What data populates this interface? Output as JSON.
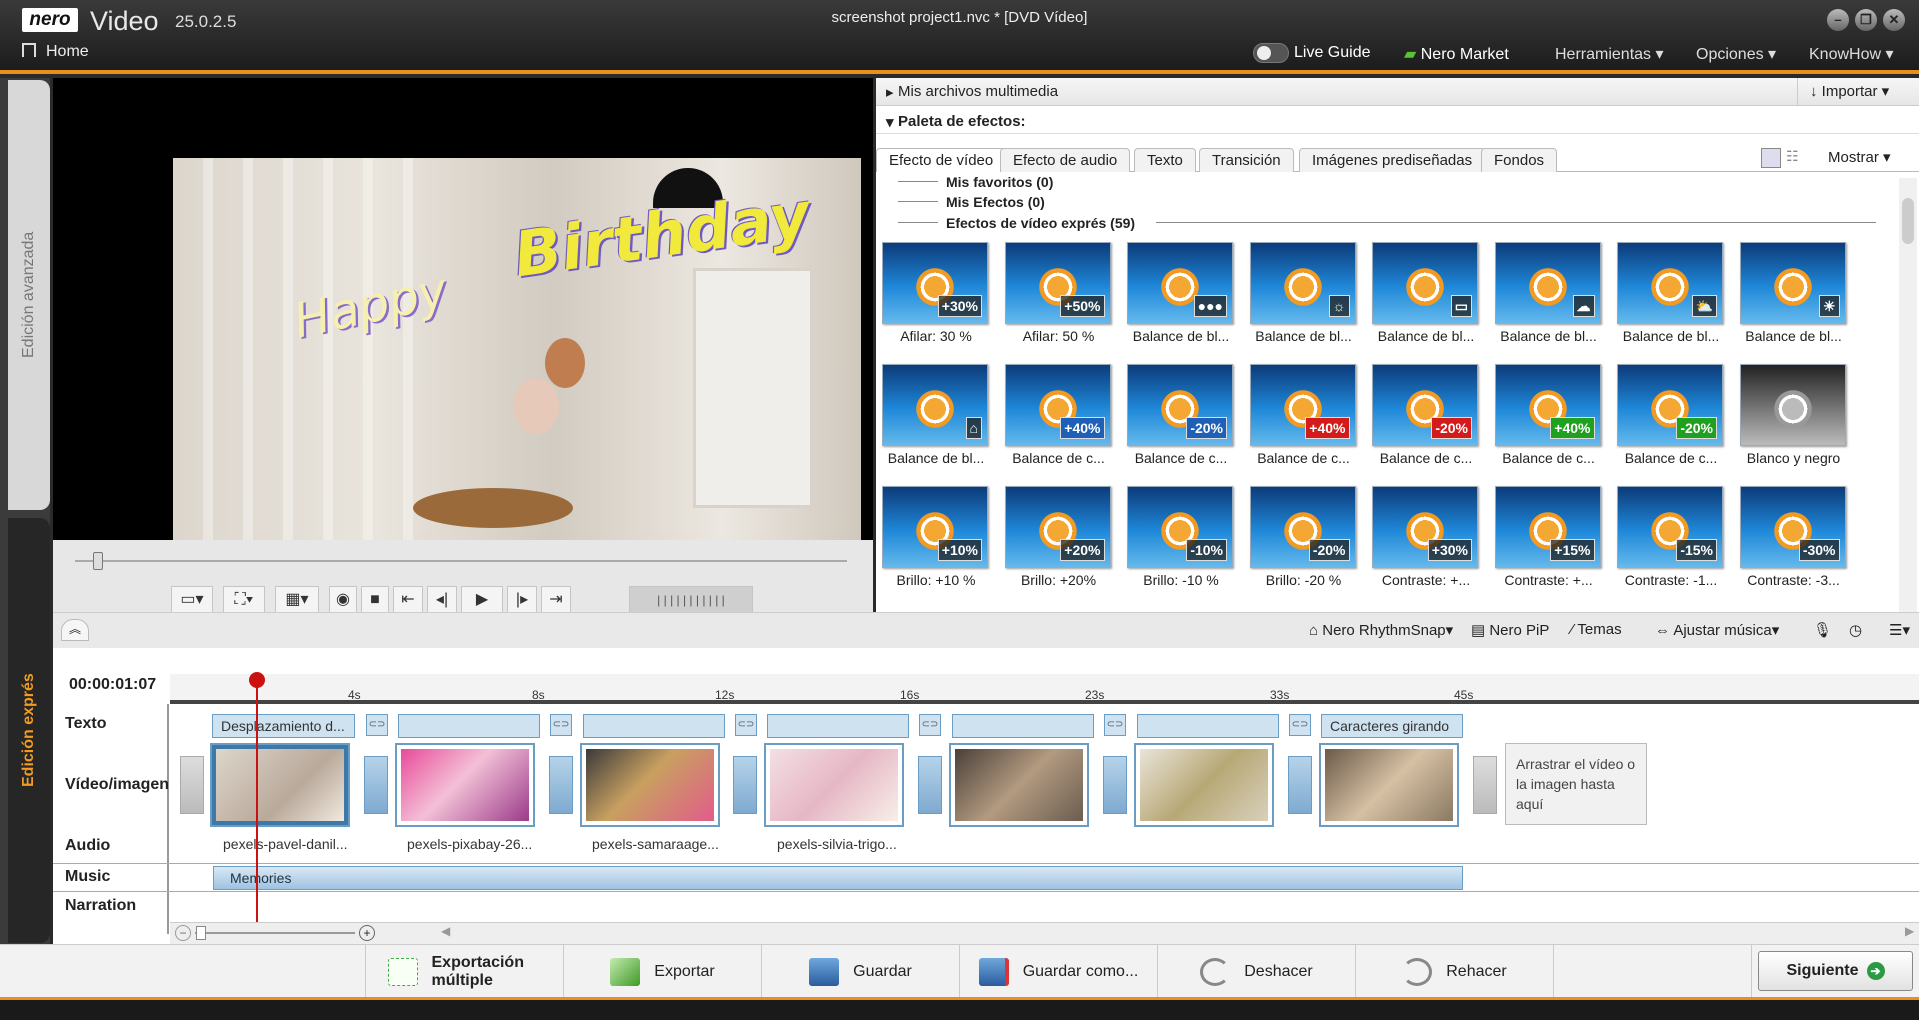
{
  "titlebar": {
    "logo": "nero",
    "app_name": "Video",
    "version": "25.0.2.5",
    "window_title": "screenshot project1.nvc * [DVD Vídeo]",
    "home": "Home",
    "live_guide": "Live Guide",
    "nero_market": "Nero Market",
    "menus": [
      "Herramientas ▾",
      "Opciones ▾",
      "KnowHow ▾"
    ]
  },
  "left_tabs": {
    "advanced": "Edición avanzada",
    "express": "Edición exprés"
  },
  "preview": {
    "title_line1": "Birthday",
    "title_line2": "Happy"
  },
  "media_panel": {
    "my_files": "Mis archivos multimedia",
    "import": "Importar ▾",
    "palette": "Paleta de efectos:",
    "tabs": [
      "Efecto de vídeo",
      "Efecto de audio",
      "Texto",
      "Transición",
      "Imágenes prediseñadas",
      "Fondos"
    ],
    "show": "Mostrar ▾",
    "categories": [
      "Mis favoritos (0)",
      "Mis Efectos (0)",
      "Efectos de vídeo exprés (59)"
    ],
    "effects": [
      {
        "label": "Afilar: 30 %",
        "badge": "+30%"
      },
      {
        "label": "Afilar: 50 %",
        "badge": "+50%"
      },
      {
        "label": "Balance de bl...",
        "badge": "●●●"
      },
      {
        "label": "Balance de bl...",
        "badge": "☼"
      },
      {
        "label": "Balance de bl...",
        "badge": "▭"
      },
      {
        "label": "Balance de bl...",
        "badge": "☁"
      },
      {
        "label": "Balance de bl...",
        "badge": "⛅"
      },
      {
        "label": "Balance de bl...",
        "badge": "☀"
      },
      {
        "label": "Balance de bl...",
        "badge": "⌂"
      },
      {
        "label": "Balance de c...",
        "badge": "+40%"
      },
      {
        "label": "Balance de c...",
        "badge": "-20%"
      },
      {
        "label": "Balance de c...",
        "badge": "+40%"
      },
      {
        "label": "Balance de c...",
        "badge": "-20%"
      },
      {
        "label": "Balance de c...",
        "badge": "+40%"
      },
      {
        "label": "Balance de c...",
        "badge": "-20%"
      },
      {
        "label": "Blanco y negro",
        "badge": ""
      },
      {
        "label": "Brillo: +10 %",
        "badge": "+10%"
      },
      {
        "label": "Brillo: +20%",
        "badge": "+20%"
      },
      {
        "label": "Brillo: -10 %",
        "badge": "-10%"
      },
      {
        "label": "Brillo: -20 %",
        "badge": "-20%"
      },
      {
        "label": "Contraste: +...",
        "badge": "+30%"
      },
      {
        "label": "Contraste: +...",
        "badge": "+15%"
      },
      {
        "label": "Contraste: -1...",
        "badge": "-15%"
      },
      {
        "label": "Contraste: -3...",
        "badge": "-30%"
      }
    ]
  },
  "timeline_toolbar": {
    "rhythmsnap": "Nero RhythmSnap▾",
    "pip": "Nero PiP",
    "temas": "Temas",
    "ajustar": "Ajustar música▾"
  },
  "timeline": {
    "timecode": "00:00:01:07",
    "ticks": [
      "4s",
      "8s",
      "12s",
      "16s",
      "23s",
      "33s",
      "45s"
    ],
    "tracks": {
      "text": "Texto",
      "video": "Vídeo/imagen",
      "audio": "Audio",
      "music": "Music",
      "narration": "Narration"
    },
    "text_clips": [
      "Desplazamiento d...",
      "",
      "",
      "",
      "",
      "",
      "Caracteres girando"
    ],
    "audio_names": [
      "pexels-pavel-danil...",
      "pexels-pixabay-26...",
      "pexels-samaraage...",
      "pexels-silvia-trigo..."
    ],
    "drop_hint": "Arrastrar el vídeo o la imagen hasta aquí",
    "music_clip": "Memories"
  },
  "bottombar": {
    "export_multi": "Exportación múltiple",
    "export": "Exportar",
    "save": "Guardar",
    "save_as": "Guardar como...",
    "undo": "Deshacer",
    "redo": "Rehacer",
    "next": "Siguiente"
  }
}
